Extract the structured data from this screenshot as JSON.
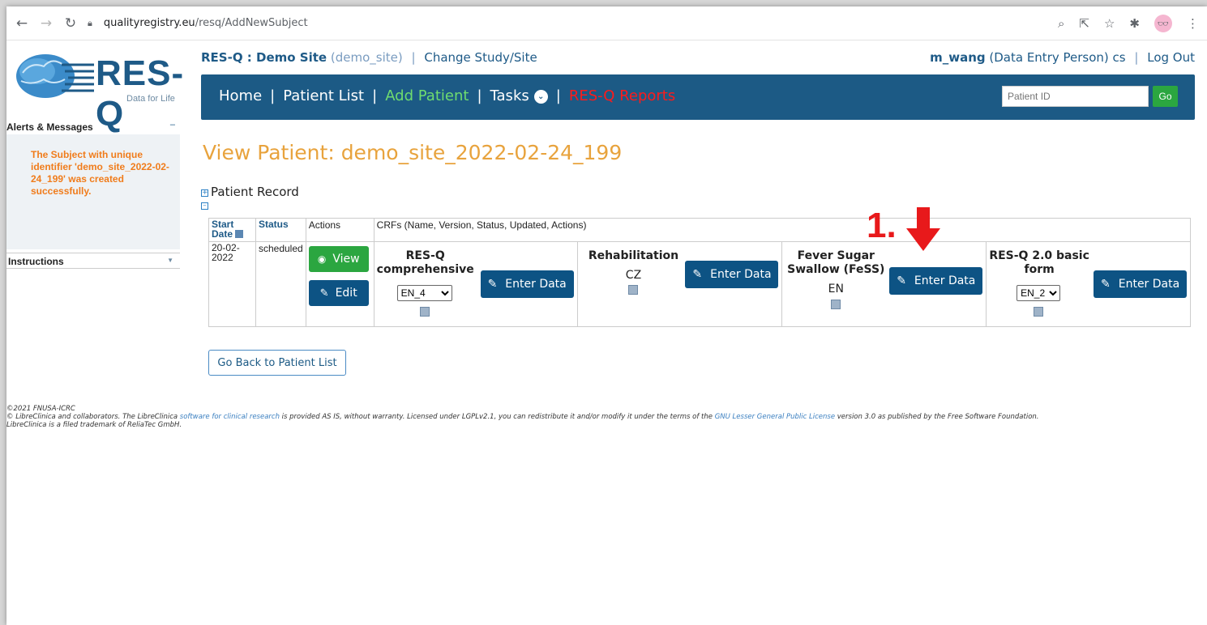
{
  "browser": {
    "url_host": "qualityregistry.eu",
    "url_path": "/resq/AddNewSubject"
  },
  "logo": {
    "text": "RES-Q",
    "subtitle": "Data for Life"
  },
  "sidebar": {
    "alerts_title": "Alerts & Messages",
    "alerts_minimize": "–",
    "alert_message": "The Subject with unique identifier 'demo_site_2022-02-24_199' was created successfully.",
    "instructions_title": "Instructions"
  },
  "header": {
    "study": "RES-Q : Demo Site",
    "site_code": "(demo_site)",
    "separator": "|",
    "change_link": "Change Study/Site",
    "user": "m_wang",
    "role": "(Data Entry Person)",
    "lang": "cs",
    "logout": "Log Out"
  },
  "nav": {
    "home": "Home",
    "patient_list": "Patient List",
    "add_patient": "Add Patient",
    "tasks": "Tasks",
    "reports": "RES-Q Reports",
    "search_placeholder": "Patient ID",
    "go_label": "Go"
  },
  "page": {
    "title": "View Patient: demo_site_2022-02-24_199",
    "section": "Patient Record",
    "back_button": "Go Back to Patient List"
  },
  "table": {
    "headers": [
      "Start Date",
      "Status",
      "Actions",
      "CRFs (Name, Version, Status, Updated, Actions)"
    ],
    "row": {
      "start_date": "20-02-2022",
      "status": "scheduled",
      "view_label": "View",
      "edit_label": "Edit"
    },
    "crfs": [
      {
        "name": "RES-Q comprehensive",
        "version": "EN_4",
        "version_type": "select",
        "action": "Enter Data"
      },
      {
        "name": "Rehabilitation",
        "version": "CZ",
        "version_type": "text",
        "action": "Enter Data"
      },
      {
        "name": "Fever Sugar Swallow (FeSS)",
        "version": "EN",
        "version_type": "text",
        "action": "Enter Data"
      },
      {
        "name": "RES-Q 2.0 basic form",
        "version": "EN_2",
        "version_type": "select",
        "action": "Enter Data"
      }
    ]
  },
  "annotation": {
    "label": "1."
  },
  "footer": {
    "copyright": "©2021 FNUSA-ICRC",
    "line1_a": "© LibreClinica and collaborators. The LibreClinica ",
    "line1_link1": "software for clinical research",
    "line1_b": " is provided AS IS, without warranty. Licensed under LGPLv2.1, you can redistribute it and/or modify it under the terms of the ",
    "line1_link2": "GNU Lesser General Public License",
    "line1_c": " version 3.0 as published by the Free Software Foundation.",
    "line2": "LibreClinica is a filed trademark of ReliaTec GmbH."
  },
  "colors": {
    "brand_blue": "#1c5a85",
    "green": "#2ba640",
    "title_orange": "#e8a33d",
    "alert_orange": "#f07c1b",
    "annotation_red": "#e8191b"
  }
}
